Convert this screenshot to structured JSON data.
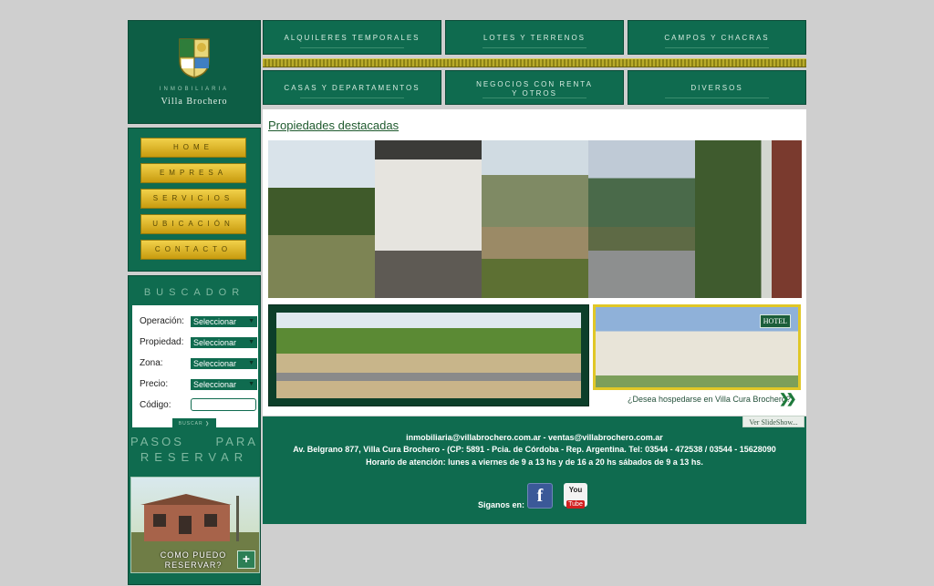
{
  "brand": {
    "subtitle": "INMOBILIARIA",
    "name": "Villa Brochero"
  },
  "categories": [
    "ALQUILERES TEMPORALES",
    "LOTES Y TERRENOS",
    "CAMPOS Y CHACRAS",
    "CASAS Y DEPARTAMENTOS",
    "NEGOCIOS CON RENTA",
    "Y OTROS",
    "DIVERSOS"
  ],
  "menu": [
    "HOME",
    "EMPRESA",
    "SERVICIOS",
    "UBICACIÓN",
    "CONTACTO"
  ],
  "search": {
    "title": "BUSCADOR",
    "fields": [
      {
        "label": "Operación:",
        "value": "Seleccionar"
      },
      {
        "label": "Propiedad:",
        "value": "Seleccionar"
      },
      {
        "label": "Zona:",
        "value": "Seleccionar"
      },
      {
        "label": "Precio:",
        "value": "Seleccionar"
      }
    ],
    "code_label": "Código:",
    "button": "BUSCAR ❯"
  },
  "steps": {
    "line1": "PASOS PARA",
    "line2": "RESERVAR",
    "card_text": "COMO PUEDO RESERVAR?"
  },
  "main": {
    "title": "Propiedades destacadas",
    "hotel_sign": "HOTEL",
    "hotel_link": "¿Desea hospedarse en Villa Cura Brochero?"
  },
  "footer": {
    "slideshow": "Ver SlideShow...",
    "emails": "inmobiliaria@villabrochero.com.ar - ventas@villabrochero.com.ar",
    "address": "Av. Belgrano 877, Villa Cura Brochero - (CP: 5891 - Pcia. de Córdoba - Rep. Argentina. Tel: 03544 - 472538 / 03544 - 15628090",
    "hours": "Horario de atención: lunes a viernes de 9 a 13 hs y de 16 a 20 hs sábados de 9 a 13 hs.",
    "follow": "Siganos en:",
    "facebook": "f",
    "youtube_you": "You",
    "youtube_tube": "Tube"
  },
  "colors": {
    "green": "#0f6b4f",
    "gold": "#e0c727",
    "background": "#cfcfcf"
  }
}
